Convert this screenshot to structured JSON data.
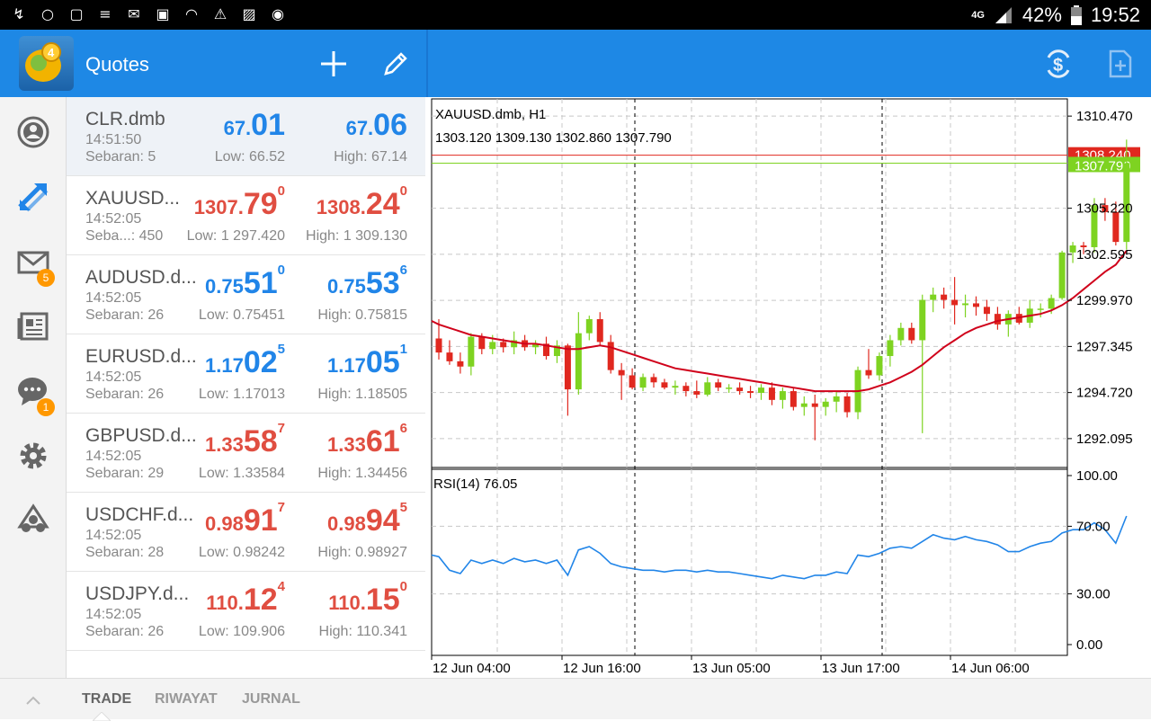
{
  "status_bar": {
    "icons": [
      "dictate-icon",
      "whatsapp-icon",
      "instagram-icon",
      "tap-app-icon",
      "mail-icon",
      "gallery-icon",
      "wifi-icon",
      "warning-icon",
      "photo-icon",
      "location-icon"
    ],
    "network": "4G",
    "battery": "42%",
    "time": "19:52"
  },
  "toolbar": {
    "title": "Quotes",
    "accent": "#1e88e5"
  },
  "sidebar": {
    "items": [
      {
        "icon": "account-icon"
      },
      {
        "icon": "trade-arrows-icon"
      },
      {
        "icon": "mail-icon",
        "badge": "5"
      },
      {
        "icon": "news-icon"
      },
      {
        "icon": "chat-icon",
        "badge": "1"
      },
      {
        "icon": "settings-icon"
      },
      {
        "icon": "community-icon"
      }
    ]
  },
  "quotes": [
    {
      "symbol": "CLR.dmb",
      "time": "14:51:50",
      "spread": "Sebaran: 5",
      "color": "blue",
      "bid_small": "67.",
      "bid_big": "01",
      "bid_sup": "",
      "ask_small": "67.",
      "ask_big": "06",
      "ask_sup": "",
      "low": "Low: 66.52",
      "high": "High: 67.14"
    },
    {
      "symbol": "XAUUSD...",
      "time": "14:52:05",
      "spread": "Seba...: 450",
      "color": "red",
      "bid_small": "1307.",
      "bid_big": "79",
      "bid_sup": "0",
      "ask_small": "1308.",
      "ask_big": "24",
      "ask_sup": "0",
      "low": "Low: 1 297.420",
      "high": "High: 1 309.130"
    },
    {
      "symbol": "AUDUSD.d...",
      "time": "14:52:05",
      "spread": "Sebaran: 26",
      "color": "blue",
      "bid_small": "0.75",
      "bid_big": "51",
      "bid_sup": "0",
      "ask_small": "0.75",
      "ask_big": "53",
      "ask_sup": "6",
      "low": "Low: 0.75451",
      "high": "High: 0.75815"
    },
    {
      "symbol": "EURUSD.d...",
      "time": "14:52:05",
      "spread": "Sebaran: 26",
      "color": "blue",
      "bid_small": "1.17",
      "bid_big": "02",
      "bid_sup": "5",
      "ask_small": "1.17",
      "ask_big": "05",
      "ask_sup": "1",
      "low": "Low: 1.17013",
      "high": "High: 1.18505"
    },
    {
      "symbol": "GBPUSD.d...",
      "time": "14:52:05",
      "spread": "Sebaran: 29",
      "color": "red",
      "bid_small": "1.33",
      "bid_big": "58",
      "bid_sup": "7",
      "ask_small": "1.33",
      "ask_big": "61",
      "ask_sup": "6",
      "low": "Low: 1.33584",
      "high": "High: 1.34456"
    },
    {
      "symbol": "USDCHF.d...",
      "time": "14:52:05",
      "spread": "Sebaran: 28",
      "color": "red",
      "bid_small": "0.98",
      "bid_big": "91",
      "bid_sup": "7",
      "ask_small": "0.98",
      "ask_big": "94",
      "ask_sup": "5",
      "low": "Low: 0.98242",
      "high": "High: 0.98927"
    },
    {
      "symbol": "USDJPY.d...",
      "time": "14:52:05",
      "spread": "Sebaran: 26",
      "color": "red",
      "bid_small": "110.",
      "bid_big": "12",
      "bid_sup": "4",
      "ask_small": "110.",
      "ask_big": "15",
      "ask_sup": "0",
      "low": "Low: 109.906",
      "high": "High: 110.341"
    }
  ],
  "chart": {
    "symbol_label": "XAUUSD.dmb, H1",
    "ohlc_label": "1303.120 1309.130 1302.860 1307.790",
    "price_levels": [
      "1310.470",
      "1305.220",
      "1302.595",
      "1299.970",
      "1297.345",
      "1294.720",
      "1292.095"
    ],
    "ask_line_label": "1308.240",
    "bid_line_label": "1307.790",
    "rsi_label": "RSI(14) 76.05",
    "rsi_levels": [
      "100.00",
      "70.00",
      "30.00",
      "0.00"
    ],
    "time_labels": [
      "12 Jun 04:00",
      "12 Jun 16:00",
      "13 Jun 05:00",
      "13 Jun 17:00",
      "14 Jun 06:00"
    ],
    "colors": {
      "bull": "#7ed321",
      "bear": "#e0281f",
      "ma": "#d0021b",
      "rsi": "#2185e8",
      "ask": "#e0281f",
      "bid": "#7ed321"
    }
  },
  "chart_data": {
    "type": "candlestick",
    "title": "XAUUSD.dmb, H1",
    "ylim": [
      1290.5,
      1311.5
    ],
    "candles": [
      [
        1297.8,
        1298.9,
        1296.6,
        1297.0
      ],
      [
        1297.0,
        1297.7,
        1296.3,
        1296.5
      ],
      [
        1296.5,
        1297.0,
        1295.8,
        1296.2
      ],
      [
        1296.2,
        1298.1,
        1295.7,
        1297.9
      ],
      [
        1297.9,
        1298.1,
        1296.9,
        1297.2
      ],
      [
        1297.2,
        1298.0,
        1296.9,
        1297.6
      ],
      [
        1297.6,
        1297.8,
        1297.0,
        1297.3
      ],
      [
        1297.3,
        1298.2,
        1296.9,
        1297.7
      ],
      [
        1297.7,
        1298.0,
        1297.1,
        1297.3
      ],
      [
        1297.3,
        1297.7,
        1296.9,
        1297.5
      ],
      [
        1297.5,
        1297.9,
        1296.6,
        1296.8
      ],
      [
        1296.8,
        1297.7,
        1296.4,
        1297.4
      ],
      [
        1297.4,
        1297.5,
        1293.4,
        1294.9
      ],
      [
        1294.9,
        1299.3,
        1294.6,
        1298.1
      ],
      [
        1298.1,
        1299.1,
        1297.7,
        1298.9
      ],
      [
        1298.9,
        1299.3,
        1297.4,
        1297.6
      ],
      [
        1297.6,
        1298.0,
        1295.8,
        1296.0
      ],
      [
        1296.0,
        1296.4,
        1294.3,
        1295.7
      ],
      [
        1295.7,
        1296.1,
        1294.9,
        1295.0
      ],
      [
        1295.0,
        1295.8,
        1294.8,
        1295.6
      ],
      [
        1295.6,
        1295.8,
        1295.0,
        1295.3
      ],
      [
        1295.3,
        1295.5,
        1294.9,
        1295.0
      ],
      [
        1295.0,
        1295.4,
        1294.6,
        1295.1
      ],
      [
        1295.1,
        1295.3,
        1294.5,
        1294.8
      ],
      [
        1294.8,
        1295.4,
        1294.4,
        1294.6
      ],
      [
        1294.6,
        1295.6,
        1294.5,
        1295.3
      ],
      [
        1295.3,
        1295.5,
        1294.8,
        1295.0
      ],
      [
        1295.0,
        1295.2,
        1294.7,
        1295.0
      ],
      [
        1295.0,
        1295.3,
        1294.6,
        1294.8
      ],
      [
        1294.8,
        1295.1,
        1294.4,
        1294.7
      ],
      [
        1294.7,
        1295.2,
        1294.3,
        1295.0
      ],
      [
        1295.0,
        1295.3,
        1294.0,
        1294.3
      ],
      [
        1294.3,
        1295.0,
        1293.8,
        1294.8
      ],
      [
        1294.8,
        1295.0,
        1293.7,
        1293.9
      ],
      [
        1293.9,
        1294.5,
        1293.4,
        1294.1
      ],
      [
        1294.1,
        1294.6,
        1292.0,
        1293.9
      ],
      [
        1293.9,
        1294.4,
        1293.4,
        1294.2
      ],
      [
        1294.2,
        1294.8,
        1293.6,
        1294.5
      ],
      [
        1294.5,
        1294.7,
        1293.3,
        1293.6
      ],
      [
        1293.6,
        1296.2,
        1293.2,
        1296.0
      ],
      [
        1296.0,
        1297.2,
        1295.5,
        1295.7
      ],
      [
        1295.7,
        1297.0,
        1295.4,
        1296.8
      ],
      [
        1296.8,
        1298.0,
        1296.2,
        1297.7
      ],
      [
        1297.7,
        1298.7,
        1297.4,
        1298.4
      ],
      [
        1298.4,
        1298.7,
        1297.5,
        1297.7
      ],
      [
        1297.7,
        1300.3,
        1292.4,
        1300.0
      ],
      [
        1300.0,
        1300.7,
        1299.3,
        1300.3
      ],
      [
        1300.3,
        1300.7,
        1299.5,
        1300.0
      ],
      [
        1300.0,
        1301.3,
        1298.6,
        1299.7
      ],
      [
        1299.7,
        1300.3,
        1299.0,
        1299.8
      ],
      [
        1299.8,
        1300.2,
        1299.1,
        1299.6
      ],
      [
        1299.6,
        1300.0,
        1298.8,
        1299.2
      ],
      [
        1299.2,
        1299.6,
        1298.3,
        1298.6
      ],
      [
        1298.6,
        1299.4,
        1297.9,
        1299.2
      ],
      [
        1299.2,
        1299.6,
        1298.6,
        1298.7
      ],
      [
        1298.7,
        1300.0,
        1298.4,
        1299.5
      ],
      [
        1299.5,
        1299.8,
        1299.0,
        1299.5
      ],
      [
        1299.5,
        1300.3,
        1299.2,
        1300.1
      ],
      [
        1300.1,
        1302.8,
        1300.0,
        1302.7
      ],
      [
        1302.7,
        1303.3,
        1302.1,
        1303.1
      ],
      [
        1303.1,
        1303.3,
        1302.6,
        1303.0
      ],
      [
        1303.0,
        1305.8,
        1302.7,
        1305.4
      ],
      [
        1305.4,
        1305.8,
        1304.5,
        1305.0
      ],
      [
        1305.0,
        1305.6,
        1303.1,
        1303.3
      ],
      [
        1303.3,
        1309.13,
        1302.86,
        1307.79
      ]
    ],
    "ma": [
      1298.6,
      1298.4,
      1298.2,
      1298.0,
      1297.9,
      1297.8,
      1297.7,
      1297.6,
      1297.5,
      1297.5,
      1297.4,
      1297.3,
      1297.2,
      1297.2,
      1297.3,
      1297.4,
      1297.3,
      1297.1,
      1296.9,
      1296.7,
      1296.5,
      1296.3,
      1296.1,
      1296.0,
      1295.9,
      1295.8,
      1295.7,
      1295.6,
      1295.5,
      1295.4,
      1295.3,
      1295.2,
      1295.1,
      1295.0,
      1294.9,
      1294.8,
      1294.8,
      1294.8,
      1294.8,
      1294.8,
      1294.9,
      1295.1,
      1295.3,
      1295.6,
      1295.9,
      1296.3,
      1296.8,
      1297.3,
      1297.7,
      1298.1,
      1298.4,
      1298.6,
      1298.8,
      1298.9,
      1299.0,
      1299.1,
      1299.2,
      1299.4,
      1299.7,
      1300.1,
      1300.6,
      1301.1,
      1301.6,
      1302.0,
      1302.8
    ],
    "rsi": [
      52,
      44,
      42,
      50,
      48,
      50,
      48,
      51,
      49,
      50,
      48,
      50,
      41,
      56,
      58,
      54,
      48,
      46,
      45,
      44,
      44,
      43,
      44,
      44,
      43,
      44,
      43,
      43,
      42,
      41,
      40,
      39,
      41,
      40,
      39,
      41,
      41,
      43,
      42,
      53,
      52,
      54,
      57,
      58,
      57,
      61,
      65,
      63,
      62,
      64,
      62,
      61,
      59,
      55,
      55,
      58,
      60,
      61,
      66,
      68,
      68,
      72,
      68,
      60,
      76.05
    ],
    "rsi_ylim": [
      0,
      100
    ],
    "series": [
      {
        "name": "RSI(14)"
      }
    ]
  }
}
